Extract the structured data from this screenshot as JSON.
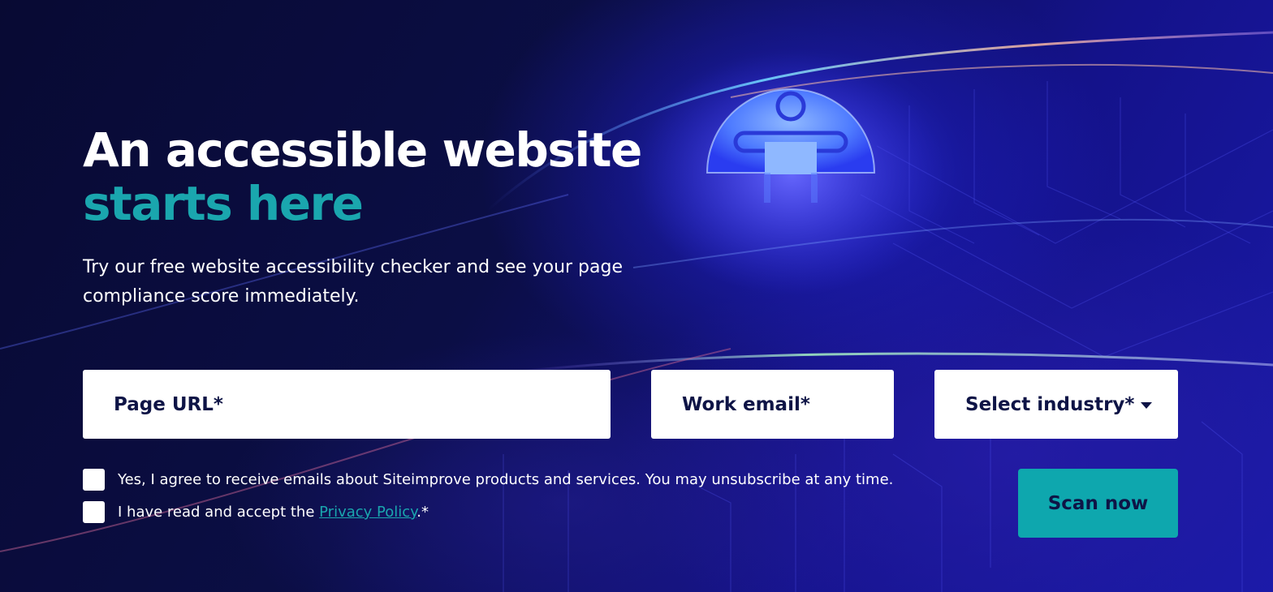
{
  "hero": {
    "title_line1": "An accessible website",
    "title_line2": "starts here",
    "subtitle": "Try our free website accessibility checker and see your page compliance score immediately.",
    "accent_color": "#1aa6ae",
    "illustration_icon": "accessibility-person-icon"
  },
  "form": {
    "page_url_placeholder": "Page URL*",
    "work_email_placeholder": "Work email*",
    "industry_placeholder": "Select industry*",
    "consent_emails_label": "Yes, I agree to receive emails about Siteimprove products and services. You may unsubscribe at any time.",
    "privacy_prefix": "I have read and accept the ",
    "privacy_link": "Privacy Policy",
    "privacy_suffix": ".*",
    "submit_label": "Scan now"
  }
}
